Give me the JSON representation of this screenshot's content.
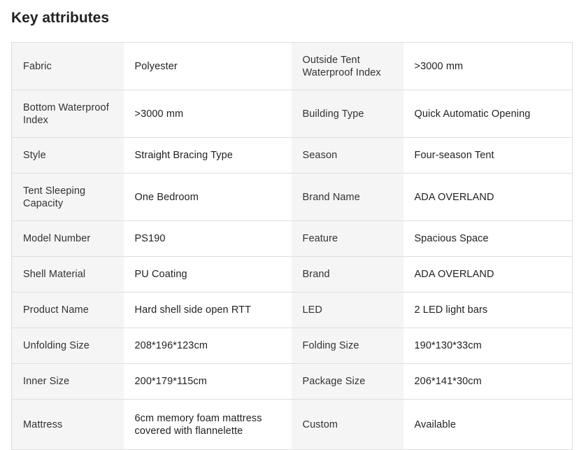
{
  "title": "Key attributes",
  "rows": [
    {
      "k1": "Fabric",
      "v1": "Polyester",
      "k2": "Outside Tent Waterproof Index",
      "v2": ">3000 mm"
    },
    {
      "k1": "Bottom Waterproof Index",
      "v1": ">3000 mm",
      "k2": "Building Type",
      "v2": "Quick Automatic Opening"
    },
    {
      "k1": "Style",
      "v1": "Straight Bracing Type",
      "k2": "Season",
      "v2": "Four-season Tent"
    },
    {
      "k1": "Tent Sleeping Capacity",
      "v1": "One Bedroom",
      "k2": "Brand Name",
      "v2": "ADA OVERLAND"
    },
    {
      "k1": "Model Number",
      "v1": "PS190",
      "k2": "Feature",
      "v2": "Spacious Space"
    },
    {
      "k1": "Shell Material",
      "v1": "PU Coating",
      "k2": "Brand",
      "v2": "ADA OVERLAND"
    },
    {
      "k1": "Product Name",
      "v1": "Hard shell side open RTT",
      "k2": "LED",
      "v2": "2 LED light bars"
    },
    {
      "k1": "Unfolding Size",
      "v1": "208*196*123cm",
      "k2": "Folding Size",
      "v2": "190*130*33cm"
    },
    {
      "k1": "Inner Size",
      "v1": "200*179*115cm",
      "k2": "Package Size",
      "v2": "206*141*30cm"
    },
    {
      "k1": "Mattress",
      "v1": "6cm memory foam mattress covered with flannelette",
      "k2": "Custom",
      "v2": "Available"
    }
  ]
}
